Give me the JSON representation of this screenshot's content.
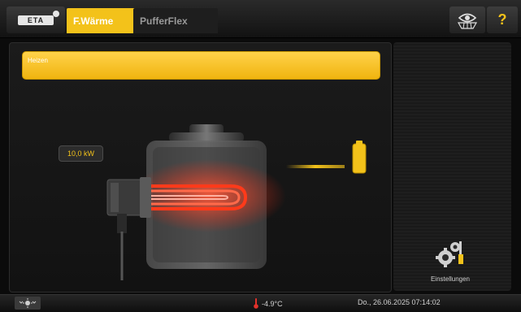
{
  "topbar": {
    "logo_text": "ETA",
    "tabs": [
      {
        "label": "F.Wärme",
        "active": true
      },
      {
        "label": "PufferFlex",
        "active": false
      }
    ],
    "help_label": "?"
  },
  "main": {
    "status_label": "Heizen",
    "power_value": "10,0 kW"
  },
  "right_panel": {
    "settings_label": "Einstellungen"
  },
  "bottombar": {
    "temperature": "-4.9°C",
    "datetime": "Do., 26.06.2025 07:14:02"
  },
  "colors": {
    "accent": "#f3c21a",
    "heater_glow": "#ff4a2a"
  }
}
